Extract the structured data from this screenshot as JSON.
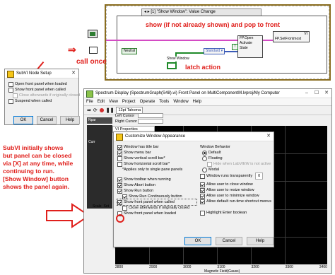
{
  "diagram": {
    "case_selector": "[1] \"Show Window\": Value Change",
    "annotation_show": "show (if not already shown) and pop to front",
    "annotation_latch": "latch action",
    "annotation_call_once": "call once",
    "neutral_label": "Neutral",
    "show_window_label": "Show Window",
    "vi_label": "VI",
    "fp_open_label": "FP.Open",
    "activate_label": "Activate",
    "state_label": "State",
    "fp_front_label": "FP.SetFrontmost",
    "standard_label": "Standard",
    "true_const": "T"
  },
  "subvi_dialog": {
    "title": "SubVI Node Setup",
    "options": [
      {
        "label": "Open front panel when loaded",
        "checked": false,
        "disabled": false
      },
      {
        "label": "Show front panel when called",
        "checked": false,
        "disabled": false
      },
      {
        "label": "Close afterwards if originally closed",
        "checked": false,
        "disabled": true
      },
      {
        "label": "Suspend when called",
        "checked": false,
        "disabled": false
      }
    ],
    "ok": "OK",
    "cancel": "Cancel",
    "help": "Help"
  },
  "note": {
    "lines": [
      "SubVI initially shows",
      "but panel can be closed",
      "via [X] at any time, while",
      "continuing to run.",
      "[Show Window] button",
      "shows the panel again."
    ]
  },
  "spectrum_window": {
    "title": "Spectrum Display (SpectrumGraph(S48).vi) Front Panel on MultiComponentM.lvproj/My Computer",
    "menu": [
      "File",
      "Edit",
      "View",
      "Project",
      "Operate",
      "Tools",
      "Window",
      "Help"
    ],
    "font_selector": "13pt Tahoma",
    "left_cursor": "Left Cursor",
    "right_cursor": "Right Cursor",
    "npar": "Npar",
    "curr_label": "Curr",
    "scale_label": "Scale",
    "set_label": "Set",
    "x_axis_label": "Magnetic Field(Gauss)",
    "x_ticks": [
      "2800",
      "2900",
      "3000",
      "3100",
      "3200",
      "3300",
      "3400"
    ],
    "vi_props_title": "VI Properties"
  },
  "customize_dialog": {
    "title": "Customize Window Appearance",
    "left_options": [
      {
        "label": "Window has title bar",
        "checked": true,
        "indent": 0,
        "disabled": false
      },
      {
        "label": "Show menu bar",
        "checked": true,
        "indent": 0,
        "disabled": false
      },
      {
        "label": "Show vertical scroll bar*",
        "checked": false,
        "indent": 0,
        "disabled": false
      },
      {
        "label": "Show horizontal scroll bar*",
        "checked": false,
        "indent": 0,
        "disabled": false
      },
      {
        "label": "*Applies only to single pane panels",
        "checked": null,
        "indent": 1,
        "disabled": false
      },
      {
        "label": "Show toolbar when running",
        "checked": true,
        "indent": 0,
        "disabled": false
      },
      {
        "label": "Show Abort button",
        "checked": true,
        "indent": 0,
        "disabled": false
      },
      {
        "label": "Show Run button",
        "checked": true,
        "indent": 0,
        "disabled": false
      },
      {
        "label": "Show Run Continuously button",
        "checked": true,
        "indent": 1,
        "disabled": false
      },
      {
        "label": "Show front panel when called",
        "checked": true,
        "indent": 0,
        "disabled": false
      },
      {
        "label": "Close afterwards if originally closed",
        "checked": false,
        "indent": 1,
        "disabled": false
      },
      {
        "label": "Show front panel when loaded",
        "checked": false,
        "indent": 0,
        "disabled": false
      }
    ],
    "behavior_title": "Window Behavior",
    "behavior_options": [
      {
        "label": "Default",
        "selected": true,
        "disabled": false
      },
      {
        "label": "Floating",
        "selected": false,
        "disabled": false
      },
      {
        "label": "Hide when LabVIEW is not active",
        "selected": null,
        "disabled": true
      },
      {
        "label": "Modal",
        "selected": false,
        "disabled": false
      }
    ],
    "transparent_label": "Window runs transparently",
    "transparent_value": "0",
    "right_options": [
      {
        "label": "Allow user to close window",
        "checked": true
      },
      {
        "label": "Allow user to resize window",
        "checked": true
      },
      {
        "label": "Allow user to minimize window",
        "checked": true
      },
      {
        "label": "Allow default run-time shortcut menus",
        "checked": true
      },
      {
        "label": "Highlight Enter boolean",
        "checked": false
      }
    ],
    "ok": "OK",
    "cancel": "Cancel",
    "help": "Help"
  }
}
